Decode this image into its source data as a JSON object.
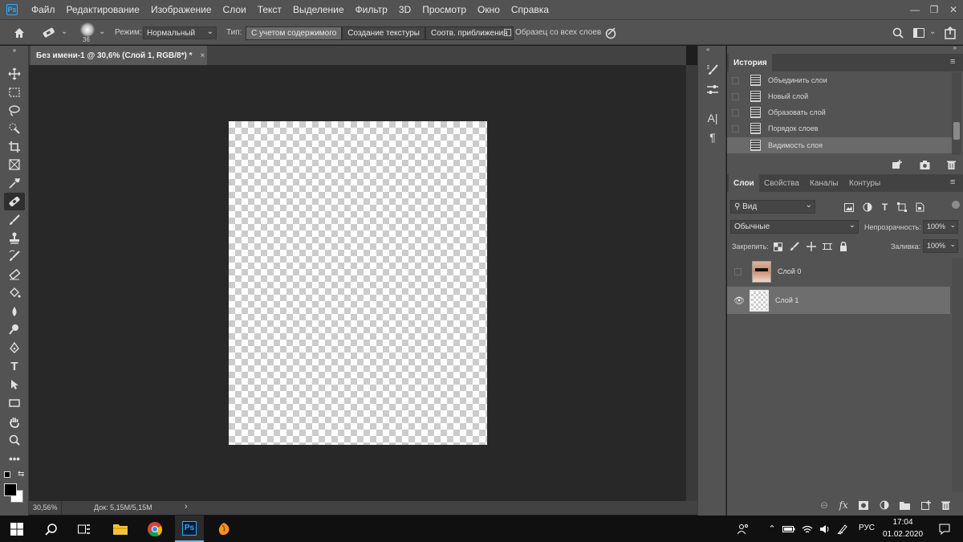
{
  "app": {
    "logo": "Ps"
  },
  "menu": [
    "Файл",
    "Редактирование",
    "Изображение",
    "Слои",
    "Текст",
    "Выделение",
    "Фильтр",
    "3D",
    "Просмотр",
    "Окно",
    "Справка"
  ],
  "window_controls": [
    "—",
    "❐",
    "✕"
  ],
  "options": {
    "brush_size": "36",
    "mode_label": "Режим:",
    "mode_value": "Нормальный",
    "type_label": "Тип:",
    "type_buttons": [
      "С учетом содержимого",
      "Создание текстуры",
      "Соотв. приближения"
    ],
    "sample_all": "Образец со всех слоев"
  },
  "document_tab": {
    "title": "Без имени-1 @ 30,6% (Слой 1, RGB/8*) *",
    "close": "×"
  },
  "status": {
    "zoom": "30,56%",
    "doc": "Док: 5,15M/5,15M",
    "arrow": "›"
  },
  "history": {
    "title": "История",
    "items": [
      "Объединить слои",
      "Новый слой",
      "Образовать слой",
      "Порядок слоев",
      "Видимость слоя"
    ],
    "selected_index": 4
  },
  "layers_panel": {
    "tabs": [
      "Слои",
      "Свойства",
      "Каналы",
      "Контуры"
    ],
    "filter_kind": "Вид",
    "blend_mode": "Обычные",
    "opacity_label": "Непрозрачность:",
    "opacity_value": "100%",
    "lock_label": "Закрепить:",
    "fill_label": "Заливка:",
    "fill_value": "100%",
    "layers": [
      {
        "name": "Слой 0",
        "visible": false,
        "selected": false
      },
      {
        "name": "Слой 1",
        "visible": true,
        "selected": true
      }
    ]
  },
  "taskbar": {
    "lang": "РУС",
    "time": "17:04",
    "date": "01.02.2020"
  },
  "colors": {
    "accent": "#31a8ff",
    "panel": "#535353",
    "canvas_bg": "#282828"
  }
}
